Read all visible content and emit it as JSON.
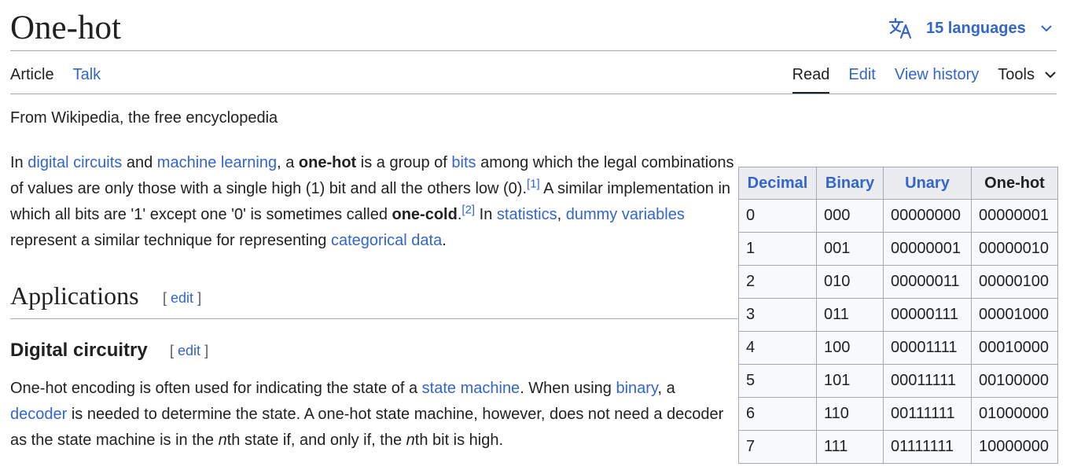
{
  "page": {
    "title": "One-hot",
    "languages_label": "15 languages",
    "tagline": "From Wikipedia, the free encyclopedia"
  },
  "tabs": {
    "article": "Article",
    "talk": "Talk",
    "read": "Read",
    "edit": "Edit",
    "view_history": "View history",
    "tools": "Tools"
  },
  "intro": {
    "t1": "In ",
    "link_digital_circuits": "digital circuits",
    "t2": " and ",
    "link_machine_learning": "machine learning",
    "t3": ", a ",
    "bold_one_hot": "one-hot",
    "t4": " is a group of ",
    "link_bits": "bits",
    "t5": " among which the legal combinations of values are only those with a single high (1) bit and all the others low (0).",
    "ref1": "[1]",
    "t6": " A similar implementation in which all bits are '1' except one '0' is sometimes called ",
    "bold_one_cold": "one-cold",
    "t7": ".",
    "ref2": "[2]",
    "t8": " In ",
    "link_statistics": "statistics",
    "t9": ", ",
    "link_dummy_variables": "dummy variables",
    "t10": " represent a similar technique for representing ",
    "link_categorical_data": "categorical data",
    "t11": "."
  },
  "sections": {
    "applications": "Applications",
    "digital_circuitry": "Digital circuitry",
    "edit_label": "edit",
    "bracket_open": "[",
    "bracket_close": "]"
  },
  "digital_para": {
    "t1": "One-hot encoding is often used for indicating the state of a ",
    "link_state_machine": "state machine",
    "t2": ". When using ",
    "link_binary": "binary",
    "t3": ", a ",
    "link_decoder": "decoder",
    "t4": " is needed to determine the state. A one-hot state machine, however, does not need a decoder as the state machine is in the ",
    "em_n1": "n",
    "t5": "th state if, and only if, the ",
    "em_n2": "n",
    "t6": "th bit is high."
  },
  "table": {
    "headers": [
      "Decimal",
      "Binary",
      "Unary",
      "One-hot"
    ],
    "rows": [
      [
        "0",
        "000",
        "00000000",
        "00000001"
      ],
      [
        "1",
        "001",
        "00000001",
        "00000010"
      ],
      [
        "2",
        "010",
        "00000011",
        "00000100"
      ],
      [
        "3",
        "011",
        "00000111",
        "00001000"
      ],
      [
        "4",
        "100",
        "00001111",
        "00010000"
      ],
      [
        "5",
        "101",
        "00011111",
        "00100000"
      ],
      [
        "6",
        "110",
        "00111111",
        "01000000"
      ],
      [
        "7",
        "111",
        "01111111",
        "10000000"
      ]
    ]
  }
}
